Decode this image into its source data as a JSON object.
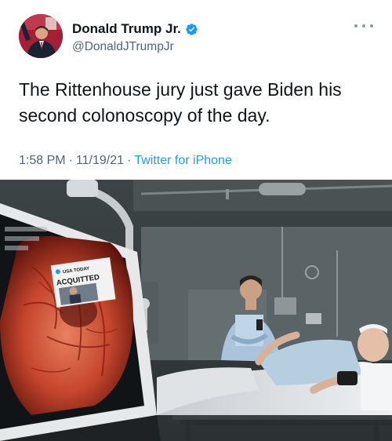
{
  "author": {
    "display_name": "Donald Trump Jr.",
    "handle": "@DonaldJTrumpJr",
    "verified": true,
    "avatar_icon": "profile-photo-icon",
    "verified_icon": "verified-badge-icon"
  },
  "menu": {
    "icon": "more-options-icon"
  },
  "tweet": {
    "text": "The Rittenhouse jury just gave Biden his second colonoscopy of the day.",
    "time": "1:58 PM",
    "separator_1": "·",
    "date": "11/19/21",
    "separator_2": "·",
    "source": "Twitter for iPhone"
  },
  "media": {
    "type": "photo",
    "badge_brand": "USA TODAY",
    "badge_headline": "ACQUITTED"
  },
  "colors": {
    "text": "#0f1419",
    "secondary": "#536471",
    "link": "#1d9bf0",
    "verified": "#1d9bf0"
  }
}
